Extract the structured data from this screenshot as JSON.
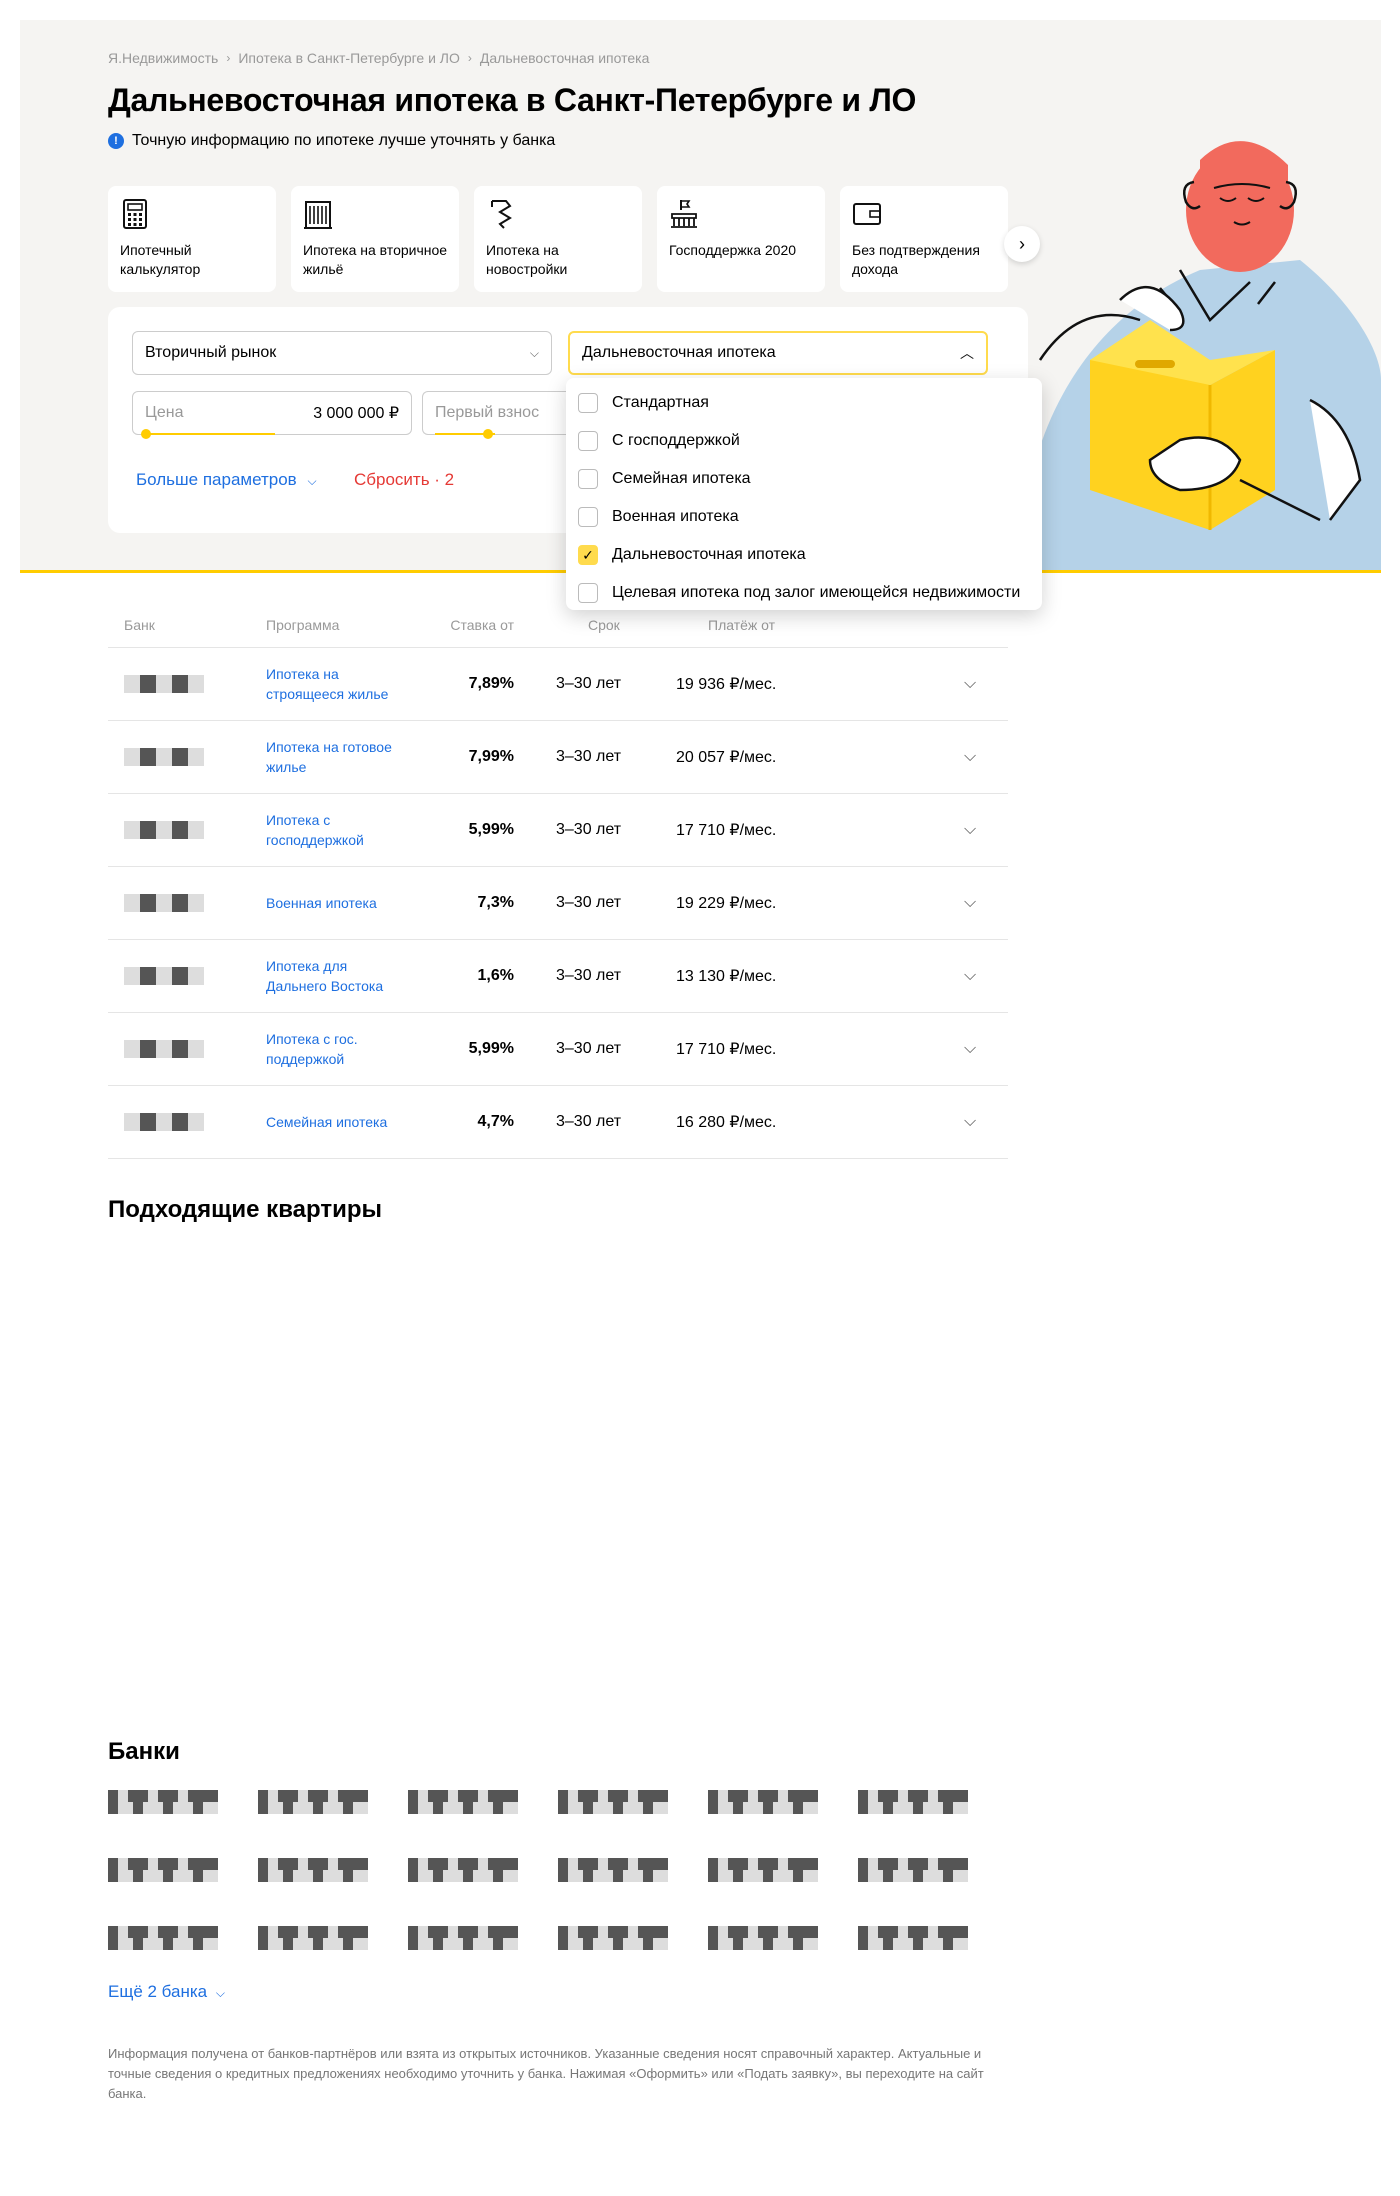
{
  "breadcrumbs": [
    "Я.Недвижимость",
    "Ипотека в Санкт-Петербурге и ЛО",
    "Дальневосточная ипотека"
  ],
  "title": "Дальневосточная ипотека в Санкт-Петербурге и ЛО",
  "note": "Точную информацию по ипотеке лучше уточнять у банка",
  "cards": [
    {
      "label": "Ипотечный калькулятор",
      "icon": "calculator-icon"
    },
    {
      "label": "Ипотека на вторичное жильё",
      "icon": "building-icon"
    },
    {
      "label": "Ипотека на новостройки",
      "icon": "crane-icon"
    },
    {
      "label": "Господдержка 2020",
      "icon": "flag-building-icon"
    },
    {
      "label": "Без подтверждения дохода",
      "icon": "wallet-icon"
    }
  ],
  "form": {
    "market": "Вторичный рынок",
    "program": "Дальневосточная ипотека",
    "price_placeholder": "Цена",
    "price_value": "3 000 000 ₽",
    "downpayment_placeholder": "Первый взнос",
    "more_params": "Больше параметров",
    "reset": "Сбросить · 2"
  },
  "dropdown": [
    {
      "label": "Стандартная",
      "checked": false
    },
    {
      "label": "С господдержкой",
      "checked": false
    },
    {
      "label": "Семейная ипотека",
      "checked": false
    },
    {
      "label": "Военная ипотека",
      "checked": false
    },
    {
      "label": "Дальневосточная ипотека",
      "checked": true
    },
    {
      "label": "Целевая ипотека под залог имеющейся недвижимости",
      "checked": false
    }
  ],
  "table": {
    "headers": {
      "bank": "Банк",
      "program": "Программа",
      "rate": "Ставка от",
      "term": "Срок",
      "payment": "Платёж от"
    },
    "rows": [
      {
        "program": "Ипотека на строящееся жилье",
        "rate": "7,89%",
        "term": "3–30 лет",
        "payment": "19 936 ₽/мес."
      },
      {
        "program": "Ипотека на готовое жилье",
        "rate": "7,99%",
        "term": "3–30 лет",
        "payment": "20 057 ₽/мес."
      },
      {
        "program": "Ипотека с господдержкой",
        "rate": "5,99%",
        "term": "3–30 лет",
        "payment": "17 710 ₽/мес."
      },
      {
        "program": "Военная ипотека",
        "rate": "7,3%",
        "term": "3–30 лет",
        "payment": "19 229 ₽/мес."
      },
      {
        "program": "Ипотека для Дальнего Востока",
        "rate": "1,6%",
        "term": "3–30 лет",
        "payment": "13 130 ₽/мес."
      },
      {
        "program": "Ипотека с гос. поддержкой",
        "rate": "5,99%",
        "term": "3–30 лет",
        "payment": "17 710 ₽/мес."
      },
      {
        "program": "Семейная ипотека",
        "rate": "4,7%",
        "term": "3–30 лет",
        "payment": "16 280 ₽/мес."
      }
    ]
  },
  "apartments_title": "Подходящие квартиры",
  "banks_title": "Банки",
  "banks_more": "Ещё 2 банка",
  "disclaimer": "Информация получена от банков-партнёров или взята из открытых источников. Указанные сведения носят справочный характер. Актуальные и точные сведения о кредитных предложениях необходимо уточнить у банка. Нажимая «Оформить» или «Подать заявку», вы переходите на сайт банка.",
  "colors": {
    "accent": "#ffcc00",
    "link": "#1e6fe0",
    "reset": "#e53935",
    "hero_bg": "#f5f4f2"
  }
}
